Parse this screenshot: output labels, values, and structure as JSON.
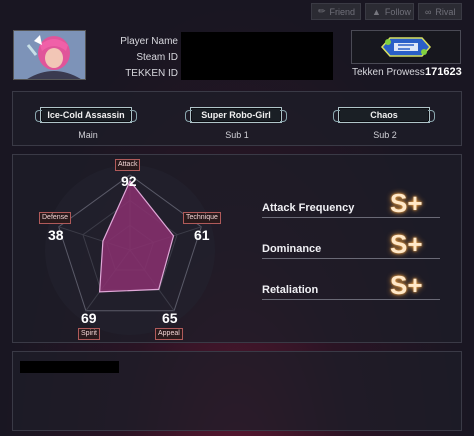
{
  "top_buttons": [
    {
      "label": "Friend",
      "icon": "add-friend-icon"
    },
    {
      "label": "Follow",
      "icon": "thumbs-up-icon"
    },
    {
      "label": "Rival",
      "icon": "link-icon"
    }
  ],
  "profile": {
    "player_name_label": "Player Name",
    "steam_id_label": "Steam ID",
    "tekken_id_label": "TEKKEN ID",
    "prowess_label": "Tekken Prowess",
    "prowess_value": "171623"
  },
  "titles": [
    {
      "name": "Ice-Cold Assassin",
      "slot": "Main"
    },
    {
      "name": "Super Robo-Girl",
      "slot": "Sub 1"
    },
    {
      "name": "Chaos",
      "slot": "Sub 2"
    }
  ],
  "stats": {
    "attack": {
      "label": "Attack",
      "value": 92
    },
    "technique": {
      "label": "Technique",
      "value": 61
    },
    "appeal": {
      "label": "Appeal",
      "value": 65
    },
    "spirit": {
      "label": "Spirit",
      "value": 69
    },
    "defense": {
      "label": "Defense",
      "value": 38
    }
  },
  "grades": [
    {
      "label": "Attack Frequency",
      "grade": "S+"
    },
    {
      "label": "Dominance",
      "grade": "S+"
    },
    {
      "label": "Retaliation",
      "grade": "S+"
    }
  ],
  "colors": {
    "radar_fill": "#8a3070",
    "radar_stroke": "#e0a8d8",
    "grade_glow": "#f0a040"
  }
}
